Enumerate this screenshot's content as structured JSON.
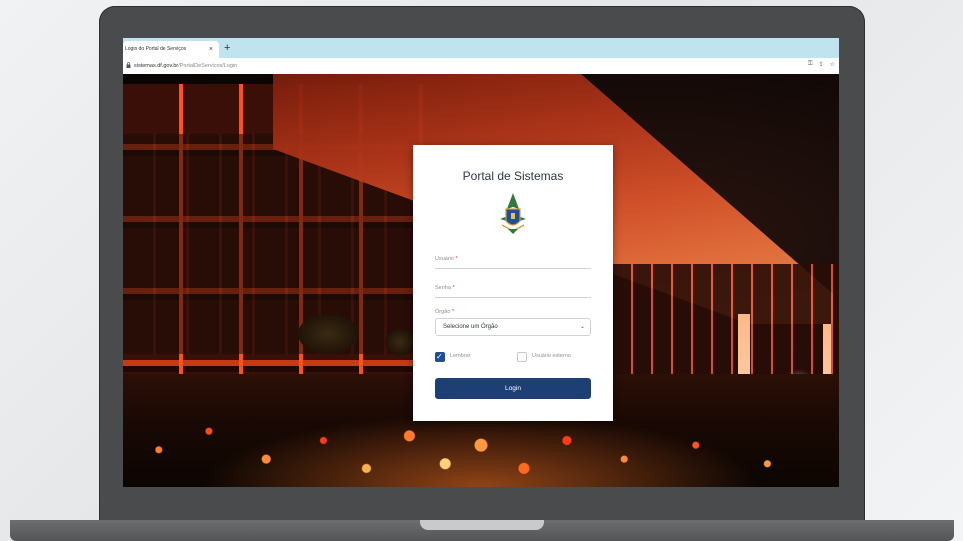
{
  "browser": {
    "tab_title": "Login do Portal de Serviços",
    "tab_close": "×",
    "new_tab": "+",
    "url_host": "sistemas.df.gov.br",
    "url_path": "/PortalDeServicos/Login",
    "icons": [
      "lock-icon",
      "key-icon",
      "share-icon",
      "star-icon"
    ]
  },
  "login": {
    "title": "Portal de Sistemas",
    "emblem": "brasilia-coat-of-arms-icon",
    "username_label": "Usuário",
    "password_label": "Senha",
    "required_mark": "*",
    "organ_label": "Órgão",
    "organ_selected": "Selecione um Órgão",
    "remember_label": "Lembrar",
    "remember_checked": true,
    "external_user_label": "Usuário externo",
    "external_user_checked": false,
    "login_button": "Login"
  },
  "colors": {
    "primary": "#1e3f73",
    "checkbox": "#1d4f91",
    "tabbar": "#bfe3ef"
  }
}
